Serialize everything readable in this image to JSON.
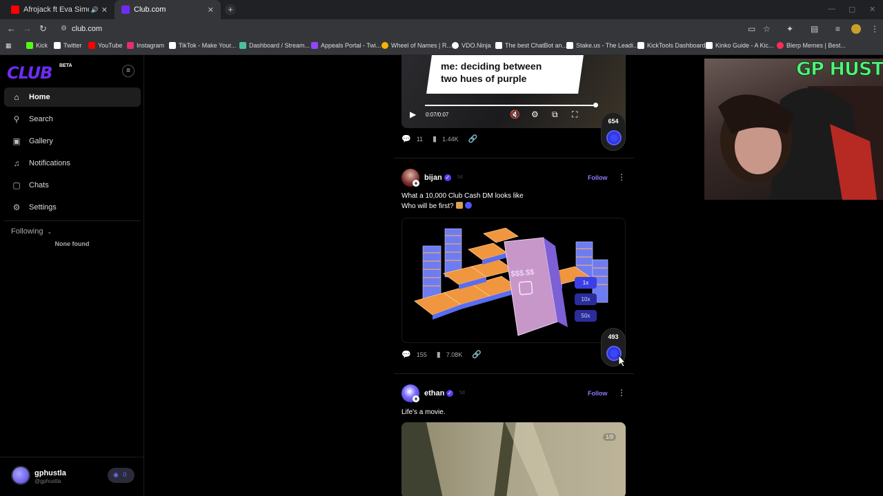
{
  "browser": {
    "tabs": [
      {
        "title": "Afrojack ft Eva Simons - Tak",
        "favicon_color": "#ff0000"
      },
      {
        "title": "Club.com",
        "favicon_color": "#6e2cf2"
      }
    ],
    "url": "club.com",
    "bookmarks": [
      {
        "label": "Kick",
        "color": "#53fc18"
      },
      {
        "label": "Twitter",
        "color": "#ffffff"
      },
      {
        "label": "YouTube",
        "color": "#ff0000"
      },
      {
        "label": "Instagram",
        "color": "#e1306c"
      },
      {
        "label": "TikTok - Make Your...",
        "color": "#ffffff"
      },
      {
        "label": "Dashboard / Stream...",
        "color": "#49c29e"
      },
      {
        "label": "Appeals Portal - Twi...",
        "color": "#9146ff"
      },
      {
        "label": "Wheel of Names | R...",
        "color": "#f4b400"
      },
      {
        "label": "VDO.Ninja",
        "color": "#ffffff"
      },
      {
        "label": "The best ChatBot an...",
        "color": "#ffffff"
      },
      {
        "label": "Stake.us - The Leadi...",
        "color": "#ffffff"
      },
      {
        "label": "KickTools Dashboard",
        "color": "#ffffff"
      },
      {
        "label": "Kinko Guide - A Kic...",
        "color": "#ffffff"
      },
      {
        "label": "Blerp Memes | Best...",
        "color": "#ff2d55"
      }
    ]
  },
  "app": {
    "logo": "CLUB",
    "beta": "BETA",
    "nav": [
      {
        "label": "Home",
        "icon": "home-icon",
        "glyph": "⌂"
      },
      {
        "label": "Search",
        "icon": "search-icon",
        "glyph": "⚲"
      },
      {
        "label": "Gallery",
        "icon": "gallery-icon",
        "glyph": "▣"
      },
      {
        "label": "Notifications",
        "icon": "bell-icon",
        "glyph": "♫"
      },
      {
        "label": "Chats",
        "icon": "chat-icon",
        "glyph": "▢"
      },
      {
        "label": "Settings",
        "icon": "gear-icon",
        "glyph": "⚙"
      }
    ],
    "following_label": "Following",
    "none_found": "None found",
    "user": {
      "name": "gphustla",
      "handle": "@gphustla",
      "balance": "0"
    },
    "accent": "#6e2cf2"
  },
  "feed": {
    "post0": {
      "video_caption": "me: deciding between two hues of purple",
      "video_time": "0:07/0:07",
      "comments": "11",
      "views": "1.44K",
      "votes": "654"
    },
    "post1": {
      "author": "bijan",
      "time": "5d",
      "follow": "Follow",
      "text_line1": "What a 10,000 Club Cash DM looks like",
      "text_line2": "Who will be first?",
      "chips": [
        "1x",
        "10x",
        "50x"
      ],
      "comments": "155",
      "views": "7.08K",
      "votes": "493"
    },
    "post2": {
      "author": "ethan",
      "time": "5d",
      "follow": "Follow",
      "text": "Life's a movie.",
      "image_count": "1/9"
    }
  },
  "overlay": {
    "webcam_title": "GP HUSTLA"
  }
}
